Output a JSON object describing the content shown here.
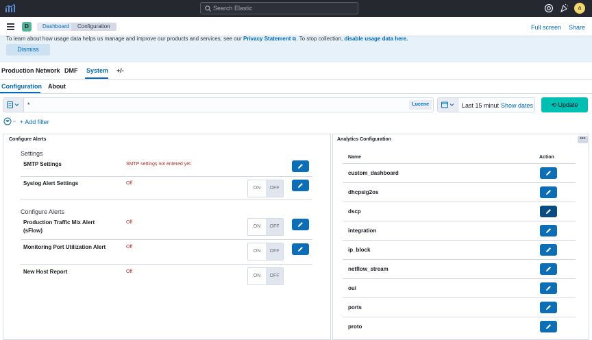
{
  "topbar": {
    "search_placeholder": "Search Elastic",
    "avatar_initial": "a"
  },
  "header": {
    "space_initial": "D",
    "breadcrumbs": [
      "Dashboard",
      "Configuration"
    ],
    "full_screen": "Full screen",
    "share": "Share"
  },
  "callout": {
    "text_before": "To learn about how usage data helps us manage and improve our products and services, see our ",
    "privacy_link": "Privacy Statement",
    "text_middle": ". To stop collection, ",
    "disable_link": "disable usage data here.",
    "dismiss": "Dismiss"
  },
  "main_tabs": [
    "Production Network",
    "DMF",
    "System",
    "+/-"
  ],
  "sub_tabs": [
    "Configuration",
    "About"
  ],
  "query": {
    "value": "*",
    "language": "Lucene"
  },
  "time": {
    "range": "Last 15 minut",
    "show_dates": "Show dates",
    "update": "Update"
  },
  "filter": {
    "add_filter": "+ Add filter"
  },
  "alerts_panel": {
    "title": "Configure Alerts",
    "settings_heading": "Settings",
    "settings": [
      {
        "name": "SMTP Settings",
        "status": "SMTP settings not entered yet."
      },
      {
        "name": "Syslog Alert Settings",
        "status": "Off",
        "on": "ON",
        "off": "OFF"
      }
    ],
    "alerts_heading": "Configure Alerts",
    "alerts": [
      {
        "name": "Production Traffic Mix Alert (sFlow)",
        "status": "Off",
        "on": "ON",
        "off": "OFF"
      },
      {
        "name": "Monitoring Port Utilization Alert",
        "status": "Off",
        "on": "ON",
        "off": "OFF"
      },
      {
        "name": "New Host Report",
        "status": "Off",
        "on": "ON",
        "off": "OFF"
      }
    ]
  },
  "analytics_panel": {
    "title": "Analytics Configuration",
    "col_name": "Name",
    "col_action": "Action",
    "rows": [
      "custom_dashboard",
      "dhcpsig2os",
      "dscp",
      "integration",
      "ip_block",
      "netflow_stream",
      "oui",
      "ports",
      "proto"
    ]
  }
}
